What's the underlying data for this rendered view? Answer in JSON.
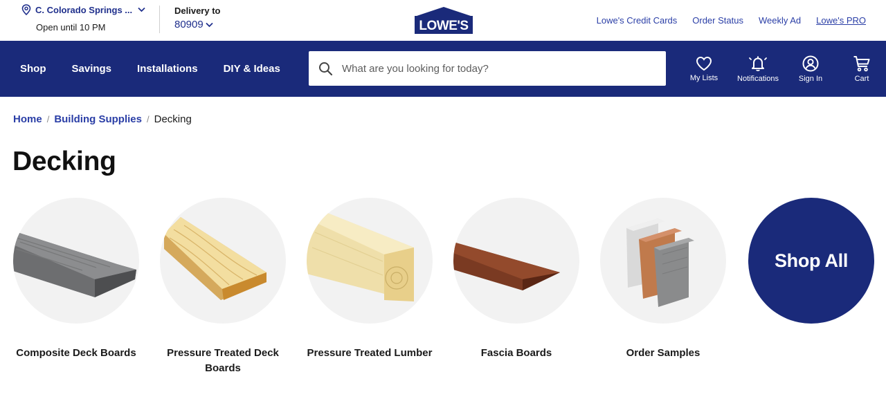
{
  "header": {
    "store_name": "C. Colorado Springs ...",
    "store_hours": "Open until 10 PM",
    "delivery_label": "Delivery to",
    "zip": "80909",
    "logo_text": "LOWE'S",
    "links": [
      {
        "label": "Lowe's Credit Cards"
      },
      {
        "label": "Order Status"
      },
      {
        "label": "Weekly Ad"
      },
      {
        "label": "Lowe's PRO"
      }
    ]
  },
  "nav": {
    "items": [
      {
        "label": "Shop"
      },
      {
        "label": "Savings"
      },
      {
        "label": "Installations"
      },
      {
        "label": "DIY & Ideas"
      }
    ],
    "search_placeholder": "What are you looking for today?",
    "icons": [
      {
        "label": "My Lists",
        "icon": "heart-icon"
      },
      {
        "label": "Notifications",
        "icon": "bell-icon"
      },
      {
        "label": "Sign In",
        "icon": "user-icon"
      },
      {
        "label": "Cart",
        "icon": "cart-icon"
      }
    ]
  },
  "breadcrumb": {
    "items": [
      {
        "label": "Home"
      },
      {
        "label": "Building Supplies"
      }
    ],
    "current": "Decking"
  },
  "page_title": "Decking",
  "categories": [
    {
      "label": "Composite Deck Boards",
      "image": "composite-board"
    },
    {
      "label": "Pressure Treated Deck Boards",
      "image": "treated-deck-board"
    },
    {
      "label": "Pressure Treated Lumber",
      "image": "treated-lumber"
    },
    {
      "label": "Fascia Boards",
      "image": "fascia-board"
    },
    {
      "label": "Order Samples",
      "image": "sample-boards"
    }
  ],
  "shop_all_label": "Shop All",
  "colors": {
    "brand_navy": "#1a2a7a",
    "link_blue": "#2a3ea6",
    "circle_bg": "#f2f2f2"
  }
}
